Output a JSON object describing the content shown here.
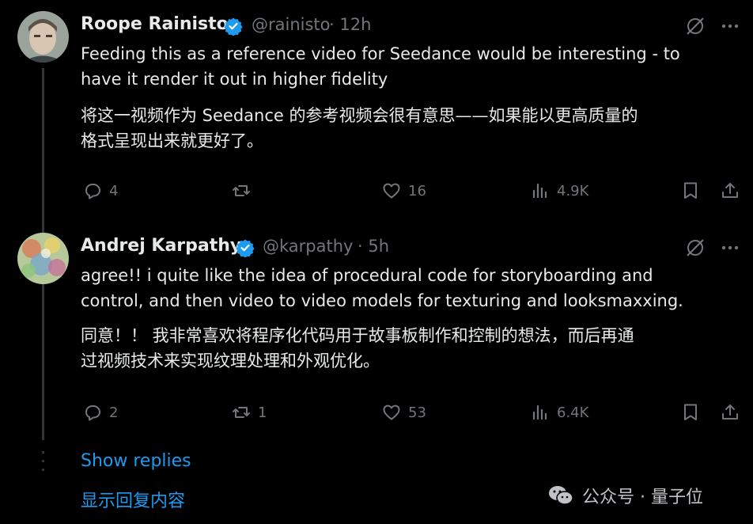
{
  "tweets": [
    {
      "author": "Roope Rainisto",
      "handle": "@rainisto",
      "time": "· 12h",
      "text_en_1": "Feeding this as a reference video for Seedance would be interesting - to",
      "text_en_2": "have it render it out in higher fidelity",
      "text_zh_1": "将这一视频作为 Seedance 的参考视频会很有意思——如果能以更高质量的",
      "text_zh_2": "格式呈现出来就更好了。",
      "stats": {
        "replies": "4",
        "reposts": "",
        "likes": "16",
        "views": "4.9K"
      }
    },
    {
      "author": "Andrej Karpathy",
      "handle": "@karpathy",
      "time": "· 5h",
      "text_en_1": "agree!! i quite like the idea of procedural code for storyboarding and",
      "text_en_2": "control, and then video to video models for texturing and looksmaxxing.",
      "text_zh_1": "同意！！ 我非常喜欢将程序化代码用于故事板制作和控制的想法，而后再通",
      "text_zh_2": "过视频技术来实现纹理处理和外观优化。",
      "stats": {
        "replies": "2",
        "reposts": "1",
        "likes": "53",
        "views": "6.4K"
      }
    }
  ],
  "show_replies": "Show replies",
  "show_replies_zh": "显示回复内容",
  "watermark": "公众号 · 量子位",
  "colors": {
    "background": "#000000",
    "text": "#e7e9ea",
    "muted": "#71767b",
    "link": "#1d9bf0",
    "verified": "#1d9bf0"
  }
}
